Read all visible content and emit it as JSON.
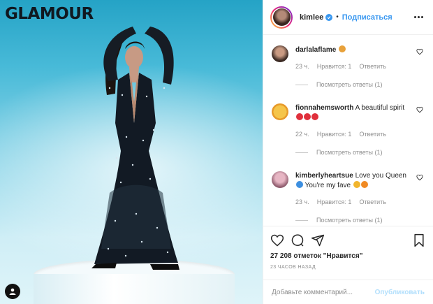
{
  "photo": {
    "brand": "GLAMOUR"
  },
  "header": {
    "username": "kimlee",
    "separator": "•",
    "follow_label": "Подписаться"
  },
  "comments": [
    {
      "username": "darlalaflame",
      "text": "",
      "emojis": [
        "#e8a13a"
      ],
      "time": "23 ч.",
      "likes": "Нравится: 1",
      "reply": "Ответить",
      "view_replies": "Посмотреть ответы (1)"
    },
    {
      "username": "fionnahemsworth",
      "text": "A beautiful spirit",
      "emojis": [
        "#e0303c",
        "#e0303c",
        "#e0303c"
      ],
      "time": "22 ч.",
      "likes": "Нравится: 1",
      "reply": "Ответить",
      "view_replies": "Посмотреть ответы (1)"
    },
    {
      "username": "kimberlyheartsue",
      "text": "Love you Queen",
      "text2": "You're my fave",
      "emojis": [
        "#3d8fe0",
        "#f1b52e",
        "#f08a24"
      ],
      "time": "23 ч.",
      "likes": "Нравится: 1",
      "reply": "Ответить",
      "view_replies": "Посмотреть ответы (1)"
    }
  ],
  "actions": {
    "likes_count": "27 208 отметок \"Нравится\"",
    "posted": "23 часов назад"
  },
  "add_comment": {
    "placeholder": "Добавьте комментарий...",
    "publish_label": "Опубликовать"
  },
  "colors": {
    "accent": "#3897f0",
    "publish_disabled": "#b2dffc",
    "text": "#262626",
    "muted": "#8e8e8e"
  },
  "icons": [
    "heart-icon",
    "comment-icon",
    "share-icon",
    "bookmark-icon",
    "verified-icon",
    "more-icon",
    "user-tag-icon"
  ]
}
